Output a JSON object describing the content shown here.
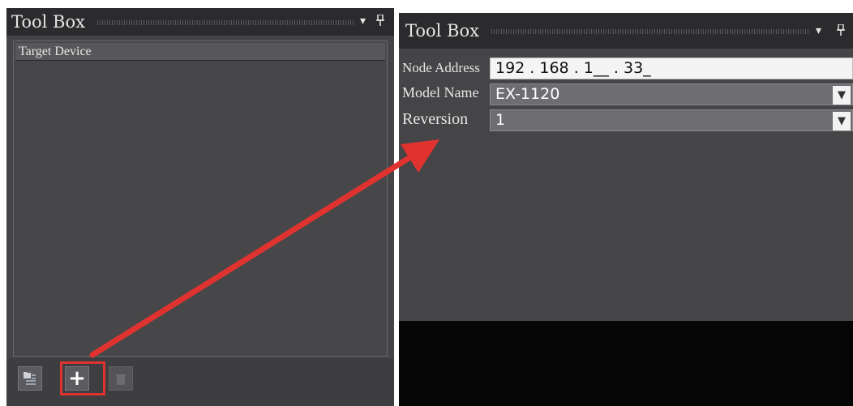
{
  "left_panel": {
    "title": "Tool Box",
    "pin_symbol": "ᵖ",
    "dropdown_symbol": "▾",
    "list_items": [
      "Target Device"
    ],
    "toolbar": {
      "add_symbol": "+"
    }
  },
  "right_panel": {
    "title": "Tool Box",
    "dropdown_symbol": "▾",
    "pin_symbol": "ᵖ",
    "node_address": {
      "label": "Node Address",
      "value": "192 . 168 . 1__ . 33_"
    },
    "model_name": {
      "label": "Model Name",
      "value": "EX-1120"
    },
    "reversion": {
      "label": "Reversion",
      "value": "1"
    },
    "combo_arrow": "▼"
  },
  "colors": {
    "annotation_red": "#e0332f",
    "panel_bg": "#454548",
    "titlebar_bg": "#2b2b2e"
  },
  "icons": [
    "folder-tree-icon",
    "plus-icon",
    "trash-icon",
    "pin-icon",
    "dropdown-icon",
    "arrow-annotation"
  ]
}
